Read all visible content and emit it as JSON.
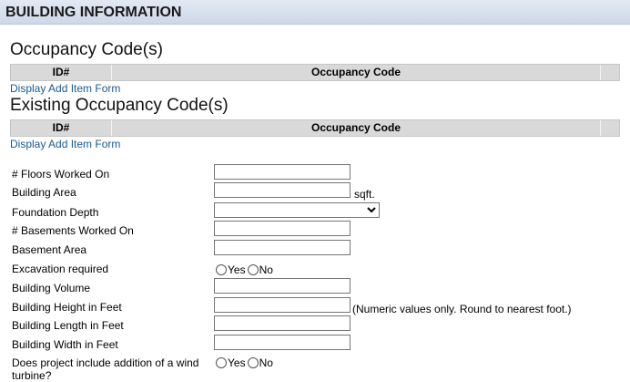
{
  "header": {
    "title": "BUILDING INFORMATION"
  },
  "occupancy": {
    "title": "Occupancy Code(s)",
    "col_id": "ID#",
    "col_code": "Occupancy Code",
    "link": "Display Add Item Form"
  },
  "existing": {
    "title": "Existing Occupancy Code(s)",
    "col_id": "ID#",
    "col_code": "Occupancy Code",
    "link": "Display Add Item Form"
  },
  "form": {
    "floors": {
      "label": "# Floors Worked On",
      "value": ""
    },
    "area": {
      "label": "Building Area",
      "value": "",
      "suffix": "sqft."
    },
    "foundation": {
      "label": "Foundation Depth",
      "selected": ""
    },
    "basements": {
      "label": "# Basements Worked On",
      "value": ""
    },
    "basement_area": {
      "label": "Basement Area",
      "value": ""
    },
    "excavation": {
      "label": "Excavation required",
      "yes": "Yes",
      "no": "No"
    },
    "volume": {
      "label": "Building Volume",
      "value": ""
    },
    "height": {
      "label": "Building Height in Feet",
      "value": "",
      "hint": "(Numeric values only. Round to nearest foot.)"
    },
    "length": {
      "label": "Building Length in Feet",
      "value": ""
    },
    "width": {
      "label": "Building Width in Feet",
      "value": ""
    },
    "wind": {
      "label": "Does project include addition of a wind turbine?",
      "yes": "Yes",
      "no": "No"
    }
  }
}
